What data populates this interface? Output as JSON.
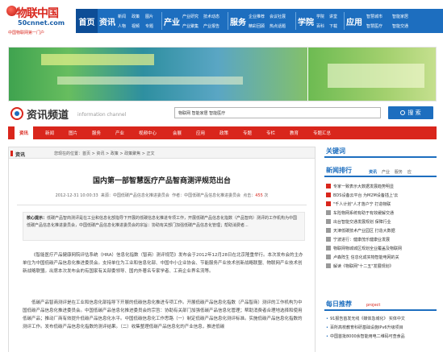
{
  "logo": {
    "brand": "物联中国",
    "domain": "50cnnet.com",
    "slogan": "中国物联网第一门户"
  },
  "topnav": [
    {
      "big": "首页",
      "links": []
    },
    {
      "big": "资讯",
      "links": [
        "新闻",
        "政策",
        "图片",
        "人物",
        "视频",
        "专题"
      ]
    },
    {
      "big": "产业",
      "links": [
        "产业研究",
        "技术动态",
        "产业聚集",
        "产业报告"
      ]
    },
    {
      "big": "服务",
      "links": [
        "企业推荐",
        "会议社展",
        "精彩回顾",
        "热点话题"
      ]
    },
    {
      "big": "学院",
      "links": [
        "学院",
        "讲堂",
        "百科",
        "下载"
      ]
    },
    {
      "big": "应用",
      "links": [
        "智慧城市",
        "智能家居",
        "智慧医疗",
        "智能交通"
      ]
    }
  ],
  "channel": {
    "title": "资讯频道",
    "subtitle": "information channel"
  },
  "search": {
    "keywords": "物联网  智能家居  智能医疗",
    "button": "搜 索"
  },
  "subnav": [
    "资讯",
    "新闻",
    "图片",
    "服务",
    "产业",
    "视频中心",
    "会展",
    "应用",
    "政策",
    "专题",
    "专栏",
    "教育",
    "专题汇总"
  ],
  "breadcrumb": {
    "tag": "资讯",
    "path": "您现在的位置：首页 > 资讯 > 政策 > 政策聚焦 > 正文"
  },
  "article": {
    "title": "国内第一部智慧医疗产品智商测评规范出台",
    "date": "2012-12-31 10:00:33",
    "author": "来源：中国低碳产品信息化推进委员会",
    "editor": "作者：中国低碳产品信息化推进委员会",
    "hits_label": "点击：",
    "hits": "455",
    "hits_unit": "次",
    "summary_label": "核心提示：",
    "summary": "低碳产品智商测评是在工业和信息化部指导下开展的低碳信息化推进专项工作，开展低碳产品信息化指数（产品智商）测评的工作机构为中国低碳产品信息化推进委员会，中国低碳产品信息化推进委员会的宗旨：协助有关部门加强低碳产品信息化管理；帮助消费者...",
    "p1": "《智能医疗产品健康网院评估系统（HRA）信息化指数（智商）测评规范》发布会于2012年12月28日在北京隆重举行。本次发布会的主办单位为中国低碳产品信息化推进委员会。支持单位为工业和信息化部、中国中小企业协会、节能服务产业技术创新战略联盟、物联网产业技术创新战略联盟。出席本次发布会的有国家有关部委领导、国内外著名专家学者、工商企业界名流等。",
    "p2": "低碳产品智商测评是在工业和信息化部指导下开展的低碳信息化推进专项工作。开展低碳产品信息化指数（产品智商）测评的工作机构为中国低碳产品信息化推进委员会。中国低碳产品信息化推进委员会的宗旨：协助有关部门加强低碳产品信息化管理；帮助消费者合理地选择和使用低碳产品；推动厂商有效提升低碳产品信息化水平。中国低碳信息化工作思路（一）制定低碳产品信息化测评标准。实施低碳产品信息化指数的测评工作。发布低碳产品信息化指数的测评结果。（二）收集整理低碳产品信息化的产业信息，推进低碳"
  },
  "side": {
    "keywords_title": "关键词",
    "rank_title": "新闻排行",
    "rank_tabs": [
      "资讯",
      "产业",
      "服务",
      "应"
    ],
    "rank": [
      "专家一致表示大数据发展趋势明显",
      "BDS设备云平台  为M2M设备插上'云",
      "\"千人计划\"人才落户宁  打造物联",
      "车险物网系统有助于有效缓解交通",
      "出台智能交通发展规划  保障行业",
      "天津低碳技术产业园区  打造大数据",
      "宁波进行：健康茂乐健康业发展",
      "物联网物城城区规划全业覆盖及物联网",
      "卢森阵生 信息化成实物智能电网的关",
      "解读《物联网\"十二五\"发展规划》"
    ],
    "daily_title": "每日推荐",
    "daily_en": "project",
    "daily": [
      "91报告首发无线《媒体急城化》 实体中文",
      "百所高校教育科研基础设施IPv6升级项目",
      "中国首批8000余智能用电二维码可查食品"
    ]
  },
  "colors": {
    "brand_red": "#d9261c",
    "nav_blue": "#1d6ebf"
  }
}
